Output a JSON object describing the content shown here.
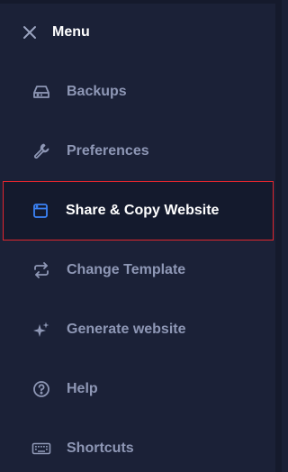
{
  "header": {
    "title": "Menu",
    "close_icon": "close-icon"
  },
  "items": [
    {
      "label": "Backups",
      "icon": "drive-icon"
    },
    {
      "label": "Preferences",
      "icon": "wrench-icon"
    },
    {
      "label": "Share & Copy Website",
      "icon": "browser-window-icon",
      "active": true
    },
    {
      "label": "Change Template",
      "icon": "swap-arrows-icon"
    },
    {
      "label": "Generate website",
      "icon": "sparkles-icon"
    },
    {
      "label": "Help",
      "icon": "help-circle-icon"
    },
    {
      "label": "Shortcuts",
      "icon": "keyboard-icon"
    }
  ],
  "colors": {
    "background": "#1b2137",
    "item_text": "#8e97b5",
    "active_text": "#ffffff",
    "active_icon": "#3b82f6",
    "highlight_border": "#e0262e"
  }
}
